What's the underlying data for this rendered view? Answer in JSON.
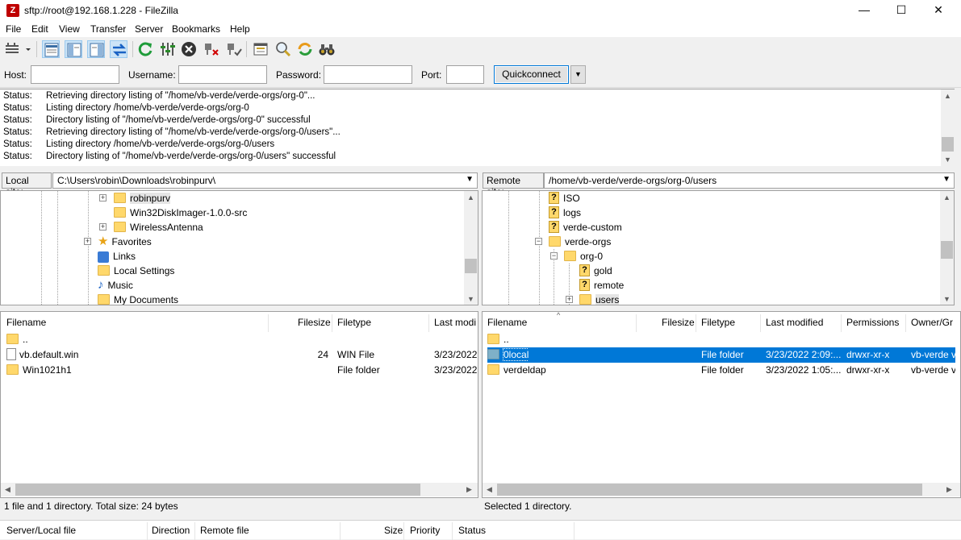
{
  "window": {
    "app_icon": "Z",
    "title": "sftp://root@192.168.1.228 - FileZilla",
    "minimize": "—",
    "maximize": "☐",
    "close": "✕"
  },
  "menu": [
    "File",
    "Edit",
    "View",
    "Transfer",
    "Server",
    "Bookmarks",
    "Help"
  ],
  "quickconnect": {
    "host_label": "Host:",
    "host_value": "",
    "username_label": "Username:",
    "username_value": "",
    "password_label": "Password:",
    "password_value": "",
    "port_label": "Port:",
    "port_value": "",
    "button": "Quickconnect",
    "arrow": "▼"
  },
  "log": [
    {
      "k": "Status:",
      "v": "Retrieving directory listing of \"/home/vb-verde/verde-orgs/org-0\"..."
    },
    {
      "k": "Status:",
      "v": "Listing directory /home/vb-verde/verde-orgs/org-0"
    },
    {
      "k": "Status:",
      "v": "Directory listing of \"/home/vb-verde/verde-orgs/org-0\" successful"
    },
    {
      "k": "Status:",
      "v": "Retrieving directory listing of \"/home/vb-verde/verde-orgs/org-0/users\"..."
    },
    {
      "k": "Status:",
      "v": "Listing directory /home/vb-verde/verde-orgs/org-0/users"
    },
    {
      "k": "Status:",
      "v": "Directory listing of \"/home/vb-verde/verde-orgs/org-0/users\" successful"
    }
  ],
  "local": {
    "site_label": "Local site:",
    "path": "C:\\Users\\robin\\Downloads\\robinpurv\\",
    "tree": [
      {
        "label": "robinpurv",
        "icon": "folder",
        "expander": "+"
      },
      {
        "label": "Win32DiskImager-1.0.0-src",
        "icon": "folder",
        "expander": ""
      },
      {
        "label": "WirelessAntenna",
        "icon": "folder",
        "expander": "+"
      },
      {
        "label": "Favorites",
        "icon": "star",
        "expander": "+"
      },
      {
        "label": "Links",
        "icon": "link",
        "expander": ""
      },
      {
        "label": "Local Settings",
        "icon": "folder",
        "expander": ""
      },
      {
        "label": "Music",
        "icon": "music",
        "expander": ""
      },
      {
        "label": "My Documents",
        "icon": "folder",
        "expander": ""
      }
    ],
    "columns": [
      "Filename",
      "Filesize",
      "Filetype",
      "Last modi"
    ],
    "files": [
      {
        "name": "..",
        "size": "",
        "type": "",
        "modified": "",
        "icon": "folder"
      },
      {
        "name": "vb.default.win",
        "size": "24",
        "type": "WIN File",
        "modified": "3/23/2022",
        "icon": "file"
      },
      {
        "name": "Win1021h1",
        "size": "",
        "type": "File folder",
        "modified": "3/23/2022",
        "icon": "folder"
      }
    ],
    "status": "1 file and 1 directory. Total size: 24 bytes"
  },
  "remote": {
    "site_label": "Remote site:",
    "path": "/home/vb-verde/verde-orgs/org-0/users",
    "tree": [
      {
        "label": "ISO",
        "icon": "qfolder",
        "expander": ""
      },
      {
        "label": "logs",
        "icon": "qfolder",
        "expander": ""
      },
      {
        "label": "verde-custom",
        "icon": "qfolder",
        "expander": ""
      },
      {
        "label": "verde-orgs",
        "icon": "folder",
        "expander": "−"
      },
      {
        "label": "org-0",
        "icon": "folder",
        "expander": "−"
      },
      {
        "label": "gold",
        "icon": "qfolder",
        "expander": ""
      },
      {
        "label": "remote",
        "icon": "qfolder",
        "expander": ""
      },
      {
        "label": "users",
        "icon": "folder",
        "expander": "+"
      }
    ],
    "columns": [
      "Filename",
      "Filesize",
      "Filetype",
      "Last modified",
      "Permissions",
      "Owner/Gr"
    ],
    "files": [
      {
        "name": "..",
        "size": "",
        "type": "",
        "modified": "",
        "perms": "",
        "owner": "",
        "icon": "folder"
      },
      {
        "name": "0local",
        "size": "",
        "type": "File folder",
        "modified": "3/23/2022 2:09:...",
        "perms": "drwxr-xr-x",
        "owner": "vb-verde v",
        "icon": "folder",
        "selected": true
      },
      {
        "name": "verdeldap",
        "size": "",
        "type": "File folder",
        "modified": "3/23/2022 1:05:...",
        "perms": "drwxr-xr-x",
        "owner": "vb-verde v",
        "icon": "folder"
      }
    ],
    "status": "Selected 1 directory."
  },
  "queue": {
    "columns": [
      "Server/Local file",
      "Direction",
      "Remote file",
      "Size",
      "Priority",
      "Status"
    ]
  },
  "colors": {
    "selection": "#0078d7",
    "folder": "#ffd86b",
    "brand": "#bf0000"
  }
}
